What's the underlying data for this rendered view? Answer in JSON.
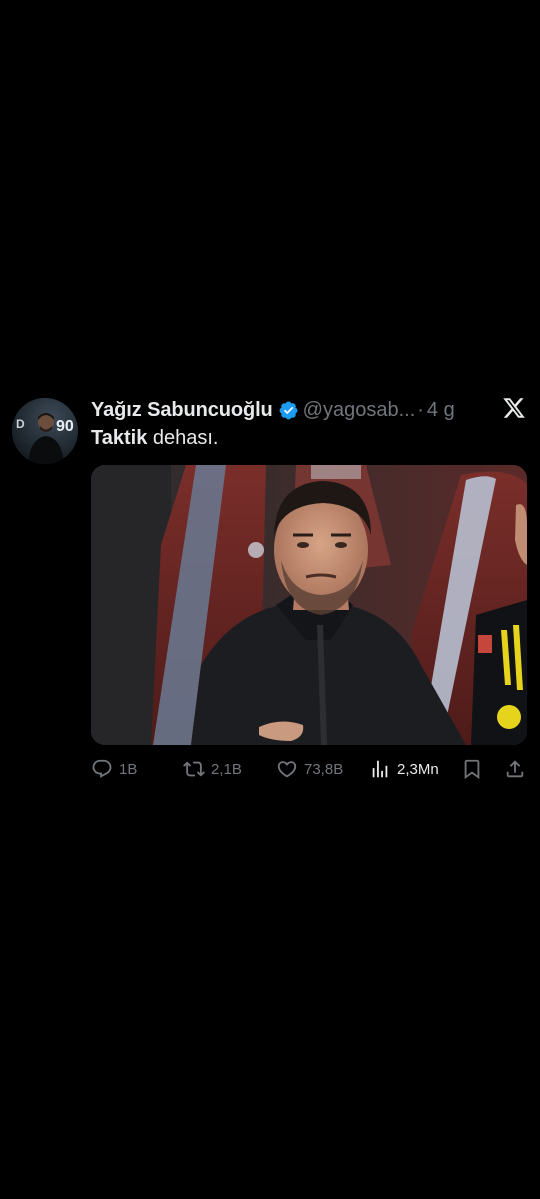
{
  "tweet": {
    "author": {
      "display_name": "Yağız Sabuncuoğlu",
      "handle": "@yagosab...",
      "verified": true,
      "verified_color": "#1d9bf0",
      "avatar_icon": "profile-photo"
    },
    "separator": "·",
    "time": "4 g",
    "text_bold": "Taktik",
    "text_rest": " dehası.",
    "media_description_icon": "photo",
    "actions": {
      "replies": "1B",
      "retweets": "2,1B",
      "likes": "73,8B",
      "views": "2,3Mn"
    },
    "icons": {
      "reply": "reply-icon",
      "retweet": "retweet-icon",
      "like": "heart-icon",
      "views": "views-icon",
      "bookmark": "bookmark-icon",
      "share": "share-icon",
      "platform": "x-logo-icon"
    }
  },
  "colors": {
    "background": "#000000",
    "primary_text": "#e7e9ea",
    "secondary_text": "#71767b",
    "accent": "#1d9bf0"
  }
}
